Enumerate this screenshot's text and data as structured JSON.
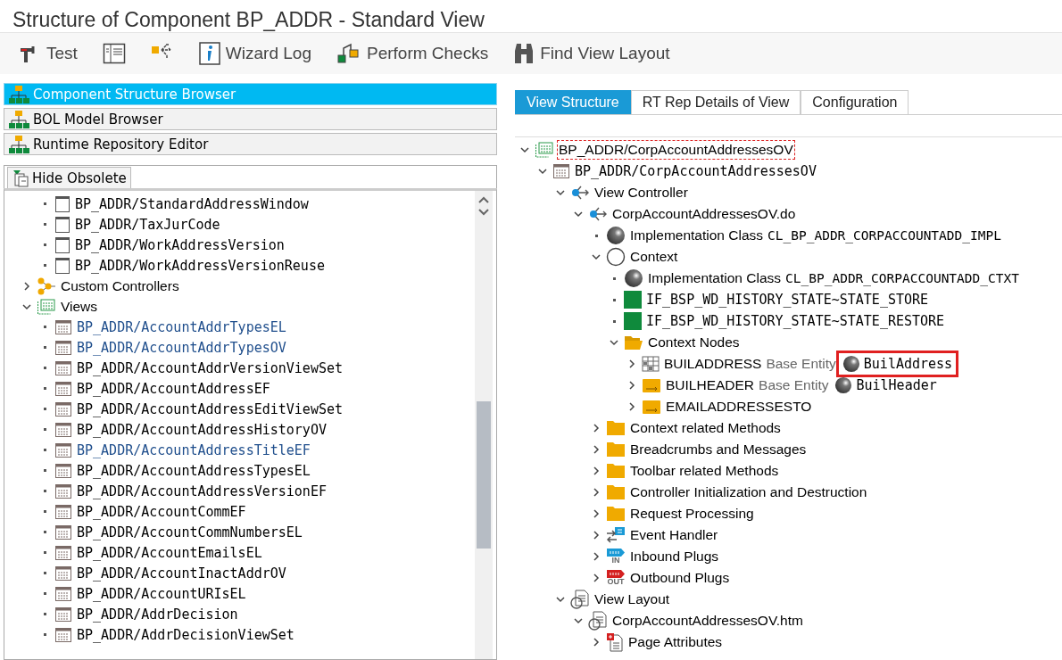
{
  "window": {
    "title": "Structure of Component BP_ADDR - Standard View"
  },
  "toolbar": [
    {
      "kind": "test",
      "label": "Test"
    },
    {
      "kind": "layout"
    },
    {
      "kind": "navigate"
    },
    {
      "kind": "info",
      "label": "Wizard Log"
    },
    {
      "kind": "checks",
      "label": "Perform Checks"
    },
    {
      "kind": "binoculars",
      "label": "Find View Layout"
    }
  ],
  "browsers": [
    {
      "label": "Component Structure Browser",
      "selected": true
    },
    {
      "label": "BOL Model Browser",
      "selected": false
    },
    {
      "label": "Runtime Repository Editor",
      "selected": false
    }
  ],
  "hide_obsolete": {
    "label": "Hide Obsolete"
  },
  "left_tree": {
    "items": [
      {
        "children": [
          {
            "kind": "window",
            "label": "BP_ADDR/StandardAddressWindow"
          },
          {
            "kind": "window",
            "label": "BP_ADDR/TaxJurCode"
          },
          {
            "kind": "window",
            "label": "BP_ADDR/WorkAddressVersion"
          },
          {
            "kind": "window",
            "label": "BP_ADDR/WorkAddressVersionReuse"
          }
        ]
      },
      {
        "kind": "custom-controllers",
        "label": "Custom Controllers",
        "expanded": false
      },
      {
        "kind": "views",
        "label": "Views",
        "expanded": true,
        "children": [
          {
            "kind": "view",
            "label": "BP_ADDR/AccountAddrTypesEL",
            "enhanced": true
          },
          {
            "kind": "view",
            "label": "BP_ADDR/AccountAddrTypesOV",
            "enhanced": true
          },
          {
            "kind": "view",
            "label": "BP_ADDR/AccountAddrVersionViewSet",
            "enhanced": false
          },
          {
            "kind": "view",
            "label": "BP_ADDR/AccountAddressEF",
            "enhanced": false
          },
          {
            "kind": "view",
            "label": "BP_ADDR/AccountAddressEditViewSet",
            "enhanced": false
          },
          {
            "kind": "view",
            "label": "BP_ADDR/AccountAddressHistoryOV",
            "enhanced": false
          },
          {
            "kind": "view",
            "label": "BP_ADDR/AccountAddressTitleEF",
            "enhanced": true
          },
          {
            "kind": "view",
            "label": "BP_ADDR/AccountAddressTypesEL",
            "enhanced": false
          },
          {
            "kind": "view",
            "label": "BP_ADDR/AccountAddressVersionEF",
            "enhanced": false
          },
          {
            "kind": "view",
            "label": "BP_ADDR/AccountCommEF",
            "enhanced": false
          },
          {
            "kind": "view",
            "label": "BP_ADDR/AccountCommNumbersEL",
            "enhanced": false
          },
          {
            "kind": "view",
            "label": "BP_ADDR/AccountEmailsEL",
            "enhanced": false
          },
          {
            "kind": "view",
            "label": "BP_ADDR/AccountInactAddrOV",
            "enhanced": false
          },
          {
            "kind": "view",
            "label": "BP_ADDR/AccountURIsEL",
            "enhanced": false
          },
          {
            "kind": "view",
            "label": "BP_ADDR/AddrDecision",
            "enhanced": false
          },
          {
            "kind": "view",
            "label": "BP_ADDR/AddrDecisionViewSet",
            "enhanced": false
          }
        ]
      }
    ]
  },
  "tabs": [
    {
      "label": "View Structure",
      "selected": true
    },
    {
      "label": "RT Rep Details of View",
      "selected": false
    },
    {
      "label": "Configuration",
      "selected": false
    }
  ],
  "right_tree": {
    "items": [
      {
        "kind": "view-root",
        "label": "BP_ADDR/CorpAccountAddressesOV",
        "expanded": true,
        "focused": true,
        "children": [
          {
            "kind": "view",
            "label": "BP_ADDR/CorpAccountAddressesOV",
            "expanded": true,
            "children": [
              {
                "kind": "controller",
                "label": "View Controller",
                "expanded": true,
                "children": [
                  {
                    "kind": "controller",
                    "label": "CorpAccountAddressesOV.do",
                    "expanded": true,
                    "children": [
                      {
                        "kind": "class",
                        "label": "Implementation Class",
                        "value": "CL_BP_ADDR_CORPACCOUNTADD_IMPL"
                      },
                      {
                        "kind": "context",
                        "label": "Context",
                        "expanded": true,
                        "children": [
                          {
                            "kind": "class",
                            "label": "Implementation Class",
                            "value": "CL_BP_ADDR_CORPACCOUNTADD_CTXT"
                          },
                          {
                            "kind": "attribute",
                            "label": "IF_BSP_WD_HISTORY_STATE~STATE_STORE"
                          },
                          {
                            "kind": "attribute",
                            "label": "IF_BSP_WD_HISTORY_STATE~STATE_RESTORE"
                          },
                          {
                            "kind": "folder-open",
                            "label": "Context Nodes",
                            "expanded": true,
                            "children": [
                              {
                                "kind": "node-table",
                                "label": "BUILADDRESS",
                                "entity_label": "Base Entity",
                                "entity": "BuilAddress",
                                "marked": true,
                                "expanded": false
                              },
                              {
                                "kind": "node-m",
                                "label": "BUILHEADER",
                                "entity_label": "Base Entity",
                                "entity": "BuilHeader",
                                "marked": false,
                                "expanded": false
                              },
                              {
                                "kind": "node-plain",
                                "label": "EMAILADDRESSESTO",
                                "expanded": false
                              }
                            ]
                          }
                        ]
                      },
                      {
                        "kind": "folder",
                        "label": "Context related Methods",
                        "expanded": false
                      },
                      {
                        "kind": "folder",
                        "label": "Breadcrumbs and Messages",
                        "expanded": false
                      },
                      {
                        "kind": "folder",
                        "label": "Toolbar related Methods",
                        "expanded": false
                      },
                      {
                        "kind": "folder",
                        "label": "Controller Initialization and Destruction",
                        "expanded": false
                      },
                      {
                        "kind": "folder",
                        "label": "Request Processing",
                        "expanded": false
                      },
                      {
                        "kind": "event",
                        "label": "Event Handler",
                        "expanded": false
                      },
                      {
                        "kind": "inbound",
                        "label": "Inbound Plugs",
                        "badge": "IN",
                        "expanded": false
                      },
                      {
                        "kind": "outbound",
                        "label": "Outbound Plugs",
                        "badge": "OUT",
                        "expanded": false
                      }
                    ]
                  }
                ]
              },
              {
                "kind": "layout",
                "label": "View Layout",
                "expanded": true,
                "children": [
                  {
                    "kind": "layout",
                    "label": "CorpAccountAddressesOV.htm",
                    "expanded": true,
                    "children": [
                      {
                        "kind": "page-attr",
                        "label": "Page Attributes",
                        "expanded": false
                      }
                    ]
                  }
                ]
              }
            ]
          }
        ]
      }
    ]
  }
}
